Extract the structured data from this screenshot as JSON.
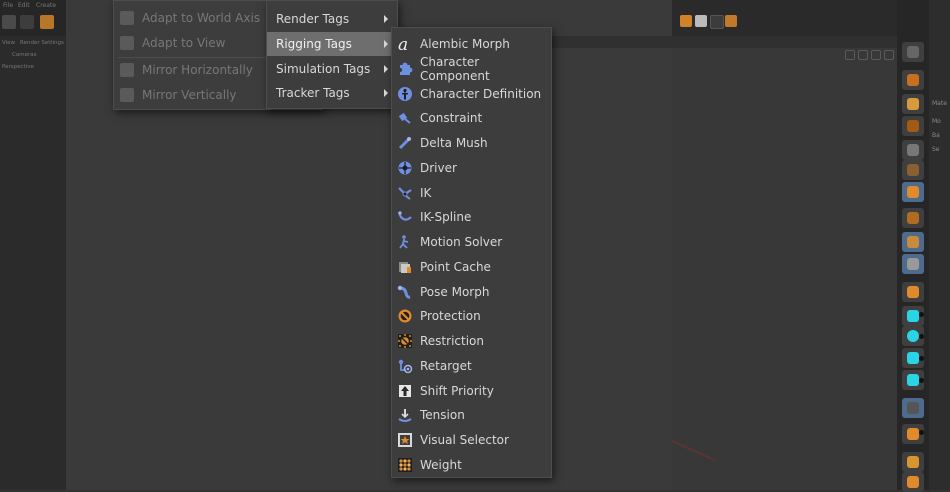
{
  "left_toolbar": {
    "menu_items": [
      "File",
      "Edit",
      "Create"
    ],
    "mini_labels": [
      "View",
      "Render Settings",
      "Cameras",
      "Perspective"
    ]
  },
  "menu_main": {
    "items": [
      {
        "label": "Adapt to World Axis",
        "icon": "world-axis-icon",
        "disabled": true
      },
      {
        "label": "Adapt to View",
        "icon": "adapt-view-icon",
        "disabled": true
      },
      {
        "label": "Mirror Horizontally",
        "icon": "mirror-horizontal-icon",
        "disabled": true
      },
      {
        "label": "Mirror Vertically",
        "icon": "mirror-vertical-icon",
        "disabled": true
      }
    ]
  },
  "menu_tags": {
    "items": [
      {
        "label": "Render Tags",
        "active": false
      },
      {
        "label": "Rigging Tags",
        "active": true
      },
      {
        "label": "Simulation Tags",
        "active": false
      },
      {
        "label": "Tracker Tags",
        "active": false
      }
    ]
  },
  "menu_rigging": {
    "items": [
      {
        "label": "Alembic Morph",
        "icon": "alembic-morph-icon"
      },
      {
        "label": "Character Component",
        "icon": "character-component-icon"
      },
      {
        "label": "Character Definition",
        "icon": "character-definition-icon"
      },
      {
        "label": "Constraint",
        "icon": "constraint-icon"
      },
      {
        "label": "Delta Mush",
        "icon": "delta-mush-icon"
      },
      {
        "label": "Driver",
        "icon": "driver-icon"
      },
      {
        "label": "IK",
        "icon": "ik-icon"
      },
      {
        "label": "IK-Spline",
        "icon": "ik-spline-icon"
      },
      {
        "label": "Motion Solver",
        "icon": "motion-solver-icon"
      },
      {
        "label": "Point Cache",
        "icon": "point-cache-icon"
      },
      {
        "label": "Pose Morph",
        "icon": "pose-morph-icon"
      },
      {
        "label": "Protection",
        "icon": "protection-icon"
      },
      {
        "label": "Restriction",
        "icon": "restriction-icon"
      },
      {
        "label": "Retarget",
        "icon": "retarget-icon"
      },
      {
        "label": "Shift Priority",
        "icon": "shift-priority-icon"
      },
      {
        "label": "Tension",
        "icon": "tension-icon"
      },
      {
        "label": "Visual Selector",
        "icon": "visual-selector-icon"
      },
      {
        "label": "Weight",
        "icon": "weight-icon"
      }
    ]
  },
  "right_panel": {
    "labels": [
      "Mate",
      "Mo",
      "Ba",
      "Se"
    ]
  },
  "colors": {
    "menu_bg": "#3d3d3d",
    "menu_hover": "#6e6e6e",
    "accent_blue": "#6f8fe0",
    "accent_orange": "#e08a2c",
    "accent_cyan": "#2ad4e6"
  }
}
